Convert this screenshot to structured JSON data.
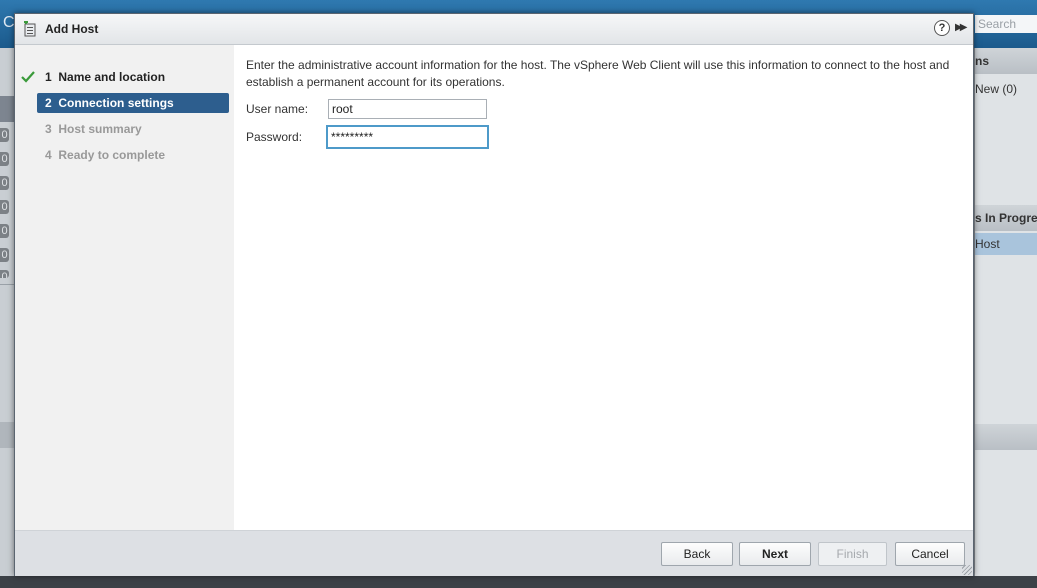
{
  "background": {
    "logo_char": "C",
    "search_placeholder": "Search",
    "badges": [
      "0",
      "0",
      "0",
      "0",
      "0",
      "0",
      "0"
    ],
    "right_panel": {
      "header1": "ns",
      "new_count": "New (0)",
      "header2": "s In Progre",
      "task_row": "Host"
    }
  },
  "dialog": {
    "title": "Add Host",
    "help_glyph": "?",
    "expand_glyph": "▶▶",
    "steps": [
      {
        "number": "1",
        "label": "Name and location",
        "state": "done"
      },
      {
        "number": "2",
        "label": "Connection settings",
        "state": "active"
      },
      {
        "number": "3",
        "label": "Host summary",
        "state": "pending"
      },
      {
        "number": "4",
        "label": "Ready to complete",
        "state": "pending"
      }
    ],
    "description": "Enter the administrative account information for the host. The vSphere Web Client will use this information to connect to the host and establish a permanent account for its operations.",
    "form": {
      "username_label": "User name:",
      "username_value": "root",
      "password_label": "Password:",
      "password_value": "*********"
    },
    "buttons": {
      "back": "Back",
      "next": "Next",
      "finish": "Finish",
      "cancel": "Cancel"
    }
  },
  "icons": {
    "title": "add-host-icon",
    "check": "check-icon",
    "help": "help-icon",
    "expand": "double-chevron-right-icon"
  },
  "colors": {
    "active_step": "#2d5e8e",
    "check": "#3a9a3a",
    "focus_border": "#4e9ac9"
  }
}
